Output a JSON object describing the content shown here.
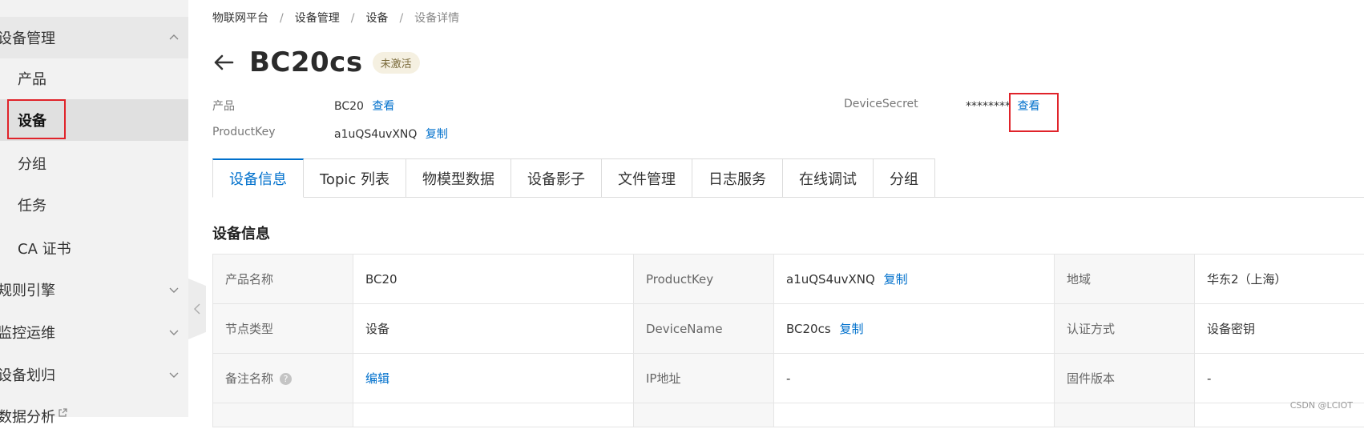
{
  "sidebar": {
    "items": [
      {
        "label": "设备管理",
        "kind": "group",
        "expanded": true
      },
      {
        "label": "产品",
        "kind": "sub"
      },
      {
        "label": "设备",
        "kind": "sub",
        "active": true
      },
      {
        "label": "分组",
        "kind": "sub"
      },
      {
        "label": "任务",
        "kind": "sub"
      },
      {
        "label": "CA 证书",
        "kind": "sub"
      },
      {
        "label": "规则引擎",
        "kind": "group"
      },
      {
        "label": "监控运维",
        "kind": "group"
      },
      {
        "label": "设备划归",
        "kind": "group"
      },
      {
        "label": "数据分析",
        "kind": "group",
        "external": true
      }
    ]
  },
  "breadcrumb": {
    "items": [
      "物联网平台",
      "设备管理",
      "设备"
    ],
    "current": "设备详情",
    "separator": "/"
  },
  "header": {
    "title": "BC20cs",
    "status": "未激活"
  },
  "meta": {
    "product_label": "产品",
    "product_value": "BC20",
    "product_link": "查看",
    "productkey_label": "ProductKey",
    "productkey_value": "a1uQS4uvXNQ",
    "productkey_link": "复制",
    "secret_label": "DeviceSecret",
    "secret_value": "********",
    "secret_link": "查看"
  },
  "tabs": [
    {
      "label": "设备信息",
      "active": true
    },
    {
      "label": "Topic 列表"
    },
    {
      "label": "物模型数据"
    },
    {
      "label": "设备影子"
    },
    {
      "label": "文件管理"
    },
    {
      "label": "日志服务"
    },
    {
      "label": "在线调试"
    },
    {
      "label": "分组"
    }
  ],
  "section": {
    "title": "设备信息"
  },
  "info": {
    "rows": [
      [
        {
          "k": "产品名称",
          "v": "BC20"
        },
        {
          "k": "ProductKey",
          "v": "a1uQS4uvXNQ",
          "link": "复制"
        },
        {
          "k": "地域",
          "v": "华东2（上海）"
        }
      ],
      [
        {
          "k": "节点类型",
          "v": "设备"
        },
        {
          "k": "DeviceName",
          "v": "BC20cs",
          "link": "复制"
        },
        {
          "k": "认证方式",
          "v": "设备密钥"
        }
      ],
      [
        {
          "k": "备注名称",
          "v": "",
          "link": "编辑",
          "help": true
        },
        {
          "k": "IP地址",
          "v": "-"
        },
        {
          "k": "固件版本",
          "v": "-"
        }
      ]
    ]
  },
  "colors": {
    "accent": "#0070cc",
    "highlight": "#e0232a",
    "sidebar_bg": "#f2f2f2"
  },
  "watermark": "CSDN @LCIOT"
}
